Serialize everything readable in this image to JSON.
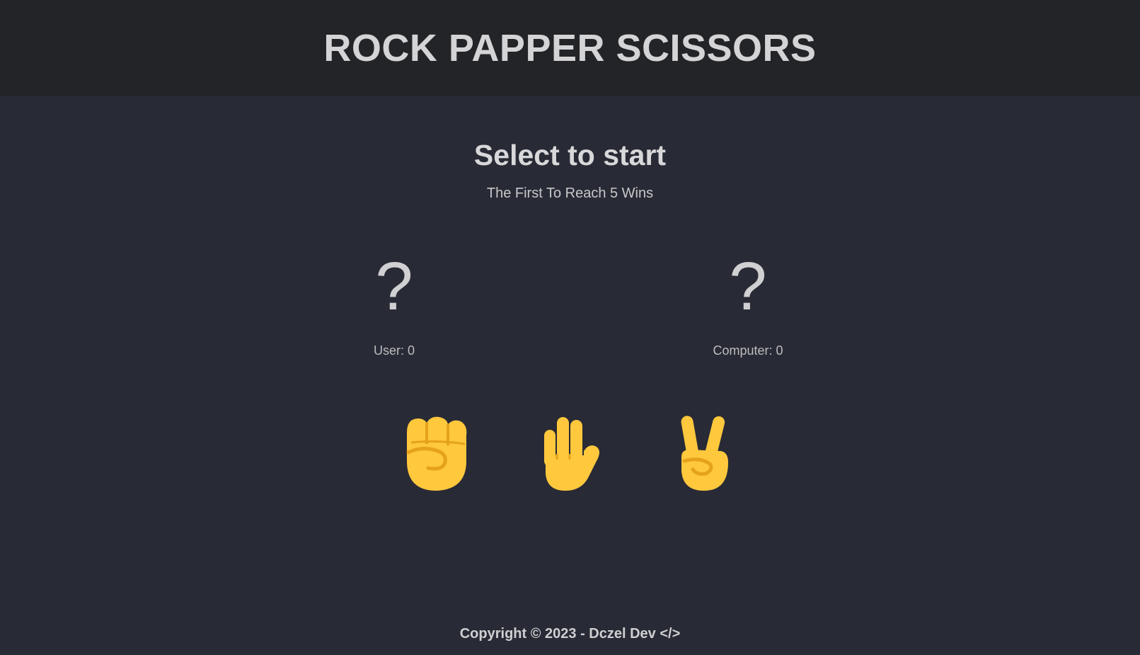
{
  "header": {
    "title": "ROCK PAPPER SCISSORS"
  },
  "status": {
    "title": "Select to start",
    "subtitle": "The First To Reach 5 Wins"
  },
  "user": {
    "choice": "?",
    "score_label": "User: 0"
  },
  "computer": {
    "choice": "?",
    "score_label": "Computer: 0"
  },
  "choices": [
    {
      "name": "rock",
      "icon": "raised-fist-icon"
    },
    {
      "name": "paper",
      "icon": "raised-hand-icon"
    },
    {
      "name": "scissors",
      "icon": "victory-hand-icon"
    }
  ],
  "colors": {
    "emoji_yellow": "#FFC83D",
    "emoji_shade": "#E5A21A",
    "header_bg": "#232428",
    "page_bg": "#282a35"
  },
  "footer": {
    "copyright": "Copyright © 2023 - Dczel Dev </>"
  }
}
